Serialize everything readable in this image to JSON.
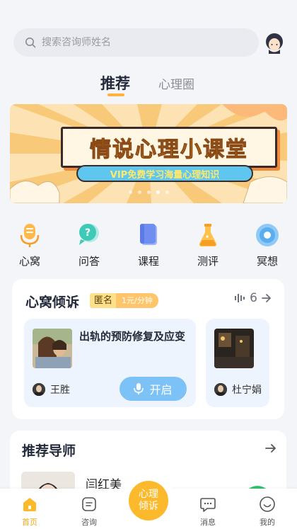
{
  "search": {
    "placeholder": "搜索咨询师姓名"
  },
  "tabs": [
    {
      "label": "推荐"
    },
    {
      "label": "心理圈"
    }
  ],
  "banner": {
    "title": "情说心理小课堂",
    "subtitle": "VIP免费学习海量心理知识"
  },
  "categories": [
    {
      "label": "心窝",
      "icon": "microphone-icon"
    },
    {
      "label": "问答",
      "icon": "question-bubble-icon"
    },
    {
      "label": "课程",
      "icon": "book-icon"
    },
    {
      "label": "测评",
      "icon": "flask-icon"
    },
    {
      "label": "冥想",
      "icon": "meditation-circle-icon"
    }
  ],
  "xinwo": {
    "title": "心窝倾诉",
    "tag": "匿名",
    "price": "1元/分钟",
    "online_count": "6",
    "cards": [
      {
        "title": "出轨的预防修复及应变",
        "person": "王胜",
        "button": "开启"
      },
      {
        "person": "杜宁娟"
      }
    ]
  },
  "mentors": {
    "title": "推荐导师",
    "first_name": "闫红美"
  },
  "nav": [
    {
      "label": "首页",
      "active": true
    },
    {
      "label": "咨询"
    },
    {
      "label": "心理倾诉"
    },
    {
      "label": "消息"
    },
    {
      "label": "我的"
    }
  ],
  "colors": {
    "accent": "#fbb92b",
    "primary_blue": "#7dc2f7",
    "text_dark": "#232a3a"
  }
}
